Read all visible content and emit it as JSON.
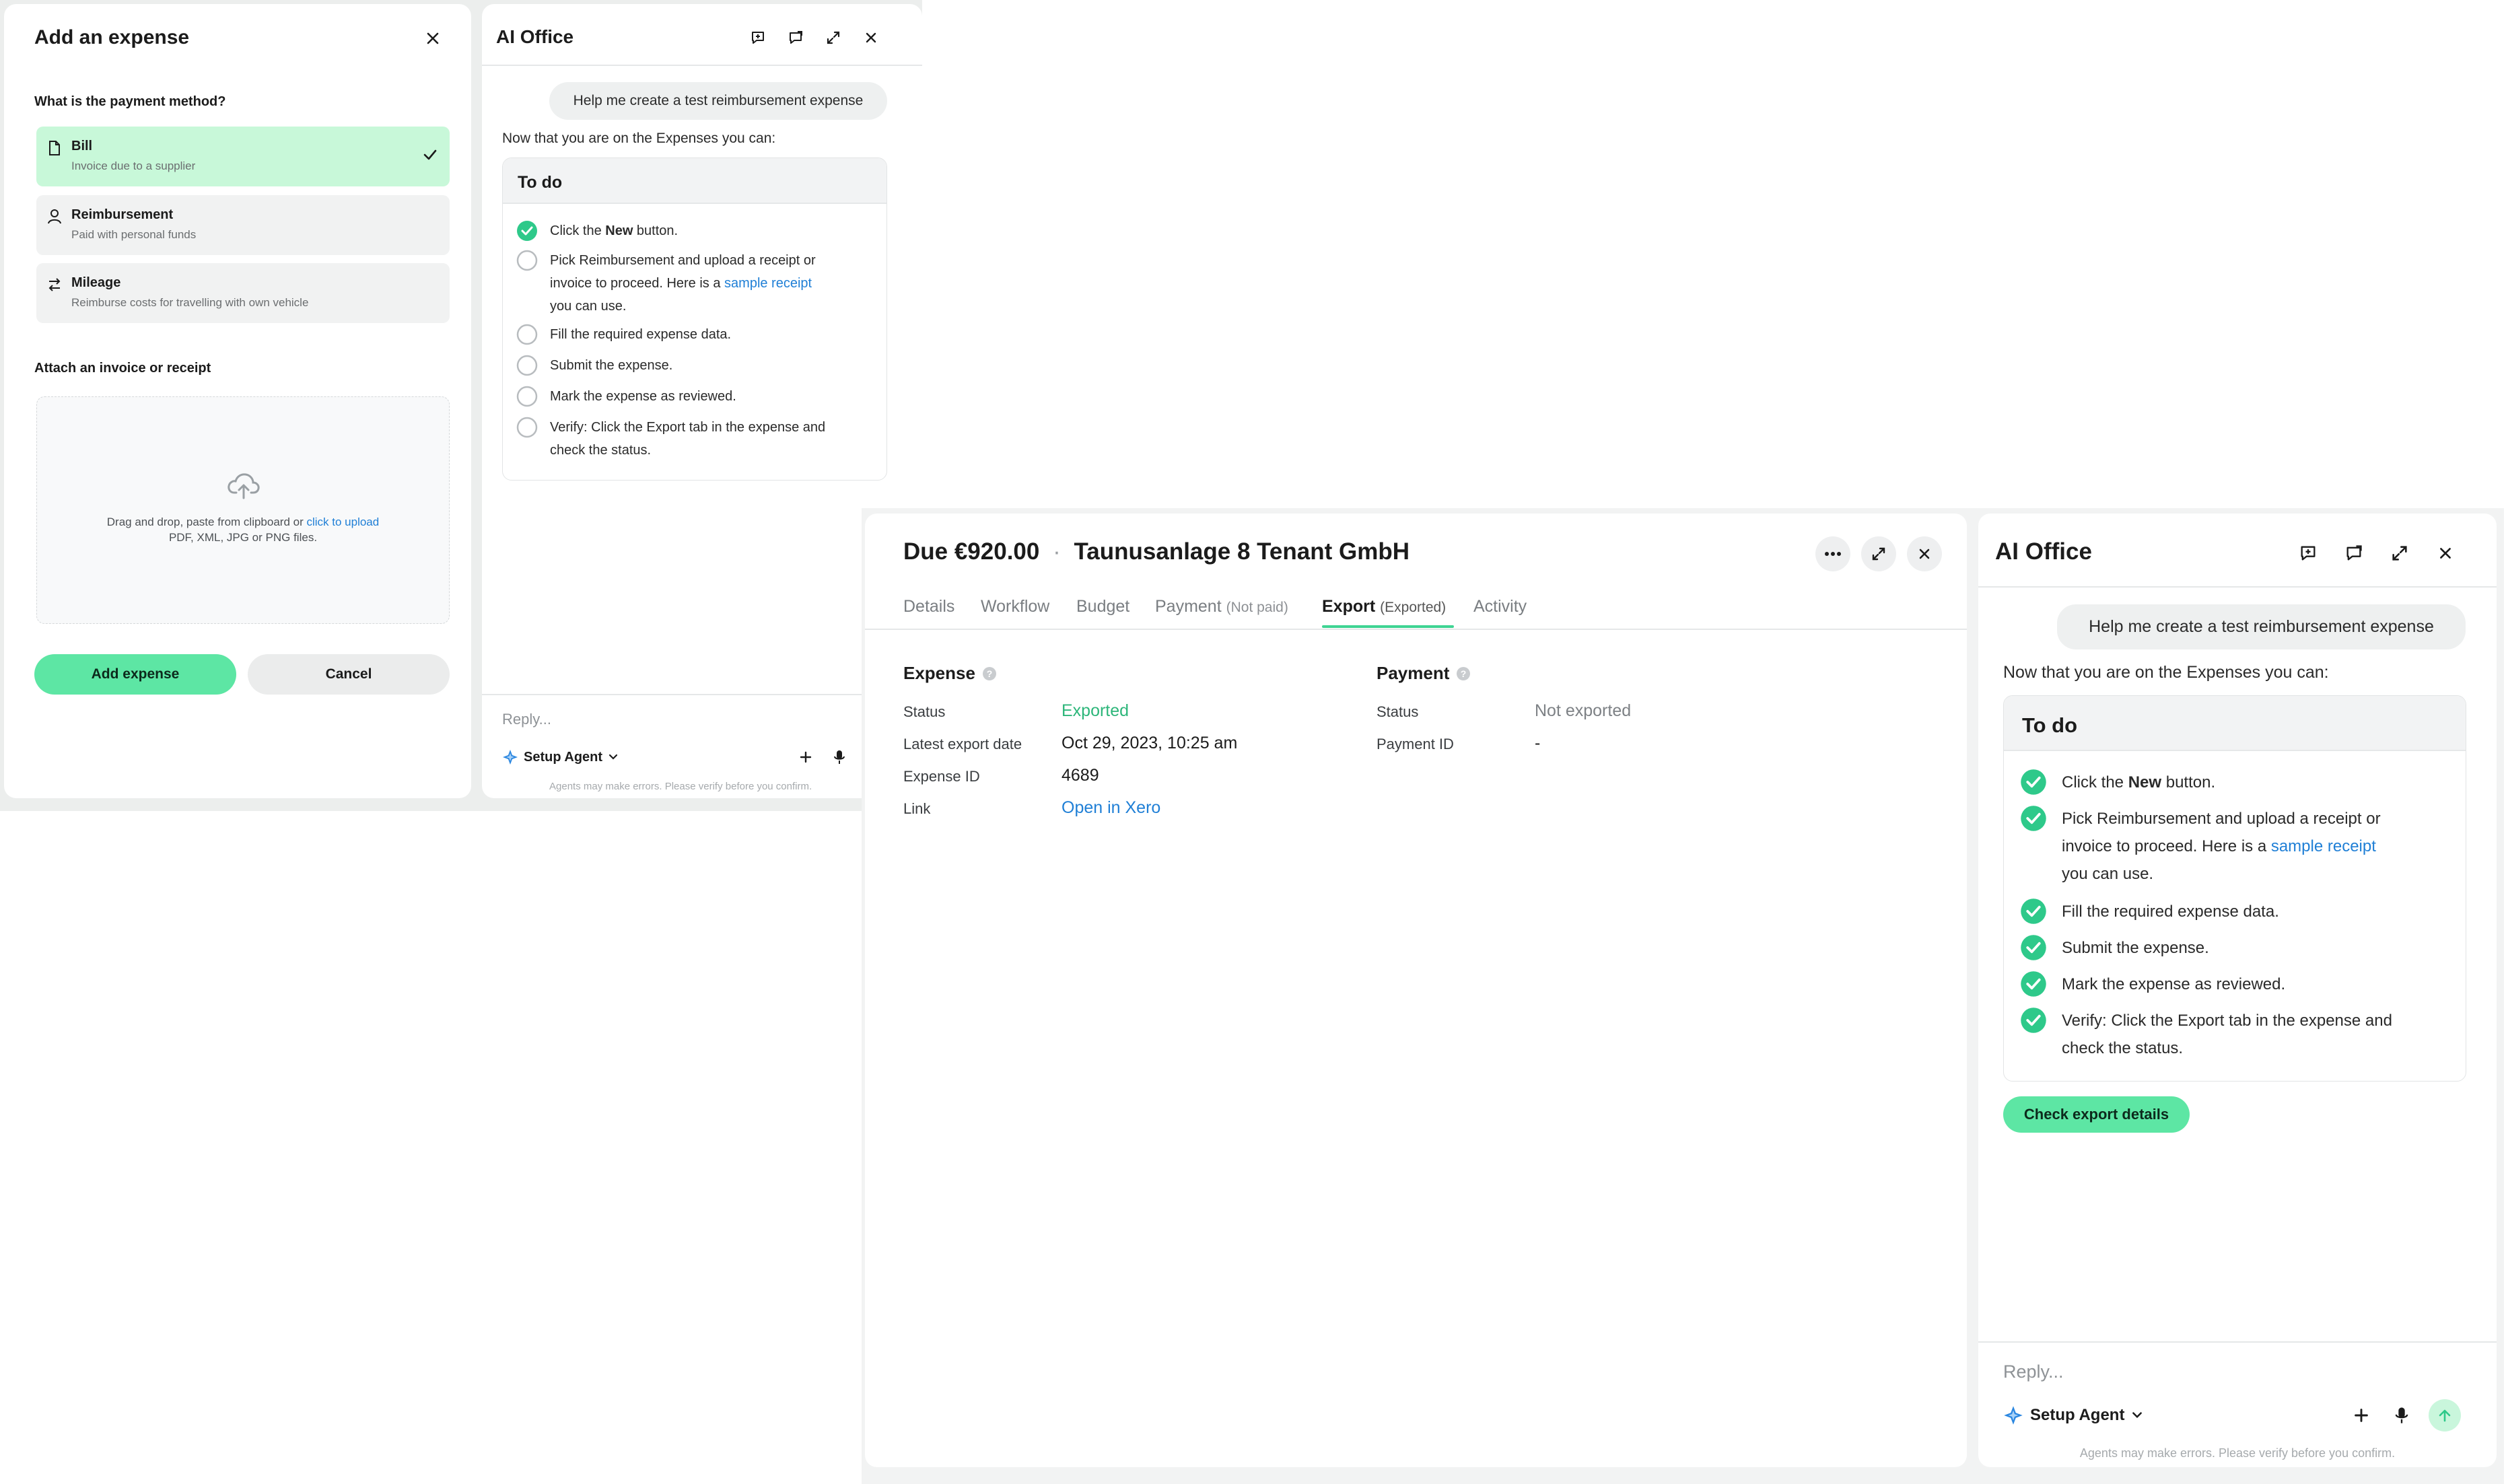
{
  "add_expense": {
    "title": "Add an expense",
    "payment_method_heading": "What is the payment method?",
    "options": [
      {
        "title": "Bill",
        "subtitle": "Invoice due to a supplier",
        "selected": true,
        "icon": "document-icon"
      },
      {
        "title": "Reimbursement",
        "subtitle": "Paid with personal funds",
        "selected": false,
        "icon": "person-icon"
      },
      {
        "title": "Mileage",
        "subtitle": "Reimburse costs for travelling with own vehicle",
        "selected": false,
        "icon": "swap-arrows-icon"
      }
    ],
    "attach_heading": "Attach an invoice or receipt",
    "dropzone": {
      "text_before": "Drag and drop, paste from clipboard or ",
      "link": "click to upload",
      "formats": "PDF, XML, JPG or PNG files."
    },
    "add_button": "Add expense",
    "cancel_button": "Cancel"
  },
  "ai_small": {
    "title": "AI Office",
    "user_message": "Help me create a test reimbursement expense",
    "intro": "Now that you are on the Expenses you can:",
    "todo_title": "To do",
    "items": [
      {
        "pre": "Click the ",
        "bold": "New",
        "post": " button.",
        "done": true
      },
      {
        "line1": "Pick Reimbursement and upload a receipt or",
        "line2_pre": "invoice to proceed. Here is a ",
        "line2_link": "sample receipt",
        "line3": "you can use.",
        "done": false
      },
      {
        "text": "Fill the required expense data.",
        "done": false
      },
      {
        "text": "Submit the expense.",
        "done": false
      },
      {
        "text": "Mark the expense as reviewed.",
        "done": false
      },
      {
        "line1": "Verify: Click the Export tab in the expense and",
        "line2": "check the status.",
        "done": false
      }
    ],
    "reply_placeholder": "Reply...",
    "agent": "Setup Agent",
    "disclaimer": "Agents may make errors. Please verify before you confirm."
  },
  "expense_detail": {
    "due": "Due €920.00",
    "separator": "·",
    "vendor": "Taunusanlage 8 Tenant GmbH",
    "tabs": [
      {
        "label": "Details",
        "sub": ""
      },
      {
        "label": "Workflow",
        "sub": ""
      },
      {
        "label": "Budget",
        "sub": ""
      },
      {
        "label": "Payment",
        "sub": "(Not paid)"
      },
      {
        "label": "Export",
        "sub": "(Exported)"
      },
      {
        "label": "Activity",
        "sub": ""
      }
    ],
    "active_tab": "Export",
    "expense_section": {
      "title": "Expense",
      "rows": [
        {
          "label": "Status",
          "value": "Exported"
        },
        {
          "label": "Latest export date",
          "value": "Oct 29, 2023, 10:25 am"
        },
        {
          "label": "Expense ID",
          "value": "4689"
        },
        {
          "label": "Link",
          "value": "Open in Xero"
        }
      ]
    },
    "payment_section": {
      "title": "Payment",
      "rows": [
        {
          "label": "Status",
          "value": "Not exported"
        },
        {
          "label": "Payment ID",
          "value": "-"
        }
      ]
    },
    "colors": {
      "exported": "#2db67a",
      "link": "#1f7fd6",
      "muted": "#7d8185"
    }
  },
  "ai_large": {
    "title": "AI Office",
    "user_message": "Help me create a test reimbursement expense",
    "intro": "Now that you are on the Expenses you can:",
    "todo_title": "To do",
    "items": [
      {
        "pre": "Click the ",
        "bold": "New",
        "post": " button.",
        "done": true
      },
      {
        "line1": "Pick Reimbursement and upload a receipt or",
        "line2_pre": "invoice to proceed. Here is a ",
        "line2_link": "sample receipt",
        "line3": "you can use.",
        "done": true
      },
      {
        "text": "Fill the required expense data.",
        "done": true
      },
      {
        "text": "Submit the expense.",
        "done": true
      },
      {
        "text": "Mark the expense as reviewed.",
        "done": true
      },
      {
        "line1": "Verify: Click the Export tab in the expense and",
        "line2": "check the status.",
        "done": true
      }
    ],
    "action_button": "Check export details",
    "reply_placeholder": "Reply...",
    "agent": "Setup Agent",
    "disclaimer": "Agents may make errors. Please verify before you confirm."
  },
  "colors": {
    "accent": "#5de6a4",
    "check": "#2ec98a",
    "link": "#1f7fd6"
  }
}
